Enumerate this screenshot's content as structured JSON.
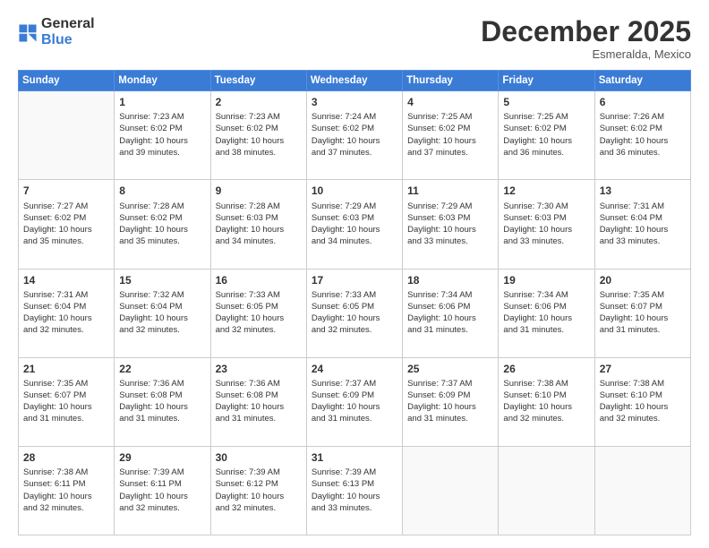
{
  "logo": {
    "general": "General",
    "blue": "Blue"
  },
  "title": "December 2025",
  "location": "Esmeralda, Mexico",
  "days_header": [
    "Sunday",
    "Monday",
    "Tuesday",
    "Wednesday",
    "Thursday",
    "Friday",
    "Saturday"
  ],
  "weeks": [
    [
      {
        "num": "",
        "info": ""
      },
      {
        "num": "1",
        "info": "Sunrise: 7:23 AM\nSunset: 6:02 PM\nDaylight: 10 hours\nand 39 minutes."
      },
      {
        "num": "2",
        "info": "Sunrise: 7:23 AM\nSunset: 6:02 PM\nDaylight: 10 hours\nand 38 minutes."
      },
      {
        "num": "3",
        "info": "Sunrise: 7:24 AM\nSunset: 6:02 PM\nDaylight: 10 hours\nand 37 minutes."
      },
      {
        "num": "4",
        "info": "Sunrise: 7:25 AM\nSunset: 6:02 PM\nDaylight: 10 hours\nand 37 minutes."
      },
      {
        "num": "5",
        "info": "Sunrise: 7:25 AM\nSunset: 6:02 PM\nDaylight: 10 hours\nand 36 minutes."
      },
      {
        "num": "6",
        "info": "Sunrise: 7:26 AM\nSunset: 6:02 PM\nDaylight: 10 hours\nand 36 minutes."
      }
    ],
    [
      {
        "num": "7",
        "info": "Sunrise: 7:27 AM\nSunset: 6:02 PM\nDaylight: 10 hours\nand 35 minutes."
      },
      {
        "num": "8",
        "info": "Sunrise: 7:28 AM\nSunset: 6:02 PM\nDaylight: 10 hours\nand 35 minutes."
      },
      {
        "num": "9",
        "info": "Sunrise: 7:28 AM\nSunset: 6:03 PM\nDaylight: 10 hours\nand 34 minutes."
      },
      {
        "num": "10",
        "info": "Sunrise: 7:29 AM\nSunset: 6:03 PM\nDaylight: 10 hours\nand 34 minutes."
      },
      {
        "num": "11",
        "info": "Sunrise: 7:29 AM\nSunset: 6:03 PM\nDaylight: 10 hours\nand 33 minutes."
      },
      {
        "num": "12",
        "info": "Sunrise: 7:30 AM\nSunset: 6:03 PM\nDaylight: 10 hours\nand 33 minutes."
      },
      {
        "num": "13",
        "info": "Sunrise: 7:31 AM\nSunset: 6:04 PM\nDaylight: 10 hours\nand 33 minutes."
      }
    ],
    [
      {
        "num": "14",
        "info": "Sunrise: 7:31 AM\nSunset: 6:04 PM\nDaylight: 10 hours\nand 32 minutes."
      },
      {
        "num": "15",
        "info": "Sunrise: 7:32 AM\nSunset: 6:04 PM\nDaylight: 10 hours\nand 32 minutes."
      },
      {
        "num": "16",
        "info": "Sunrise: 7:33 AM\nSunset: 6:05 PM\nDaylight: 10 hours\nand 32 minutes."
      },
      {
        "num": "17",
        "info": "Sunrise: 7:33 AM\nSunset: 6:05 PM\nDaylight: 10 hours\nand 32 minutes."
      },
      {
        "num": "18",
        "info": "Sunrise: 7:34 AM\nSunset: 6:06 PM\nDaylight: 10 hours\nand 31 minutes."
      },
      {
        "num": "19",
        "info": "Sunrise: 7:34 AM\nSunset: 6:06 PM\nDaylight: 10 hours\nand 31 minutes."
      },
      {
        "num": "20",
        "info": "Sunrise: 7:35 AM\nSunset: 6:07 PM\nDaylight: 10 hours\nand 31 minutes."
      }
    ],
    [
      {
        "num": "21",
        "info": "Sunrise: 7:35 AM\nSunset: 6:07 PM\nDaylight: 10 hours\nand 31 minutes."
      },
      {
        "num": "22",
        "info": "Sunrise: 7:36 AM\nSunset: 6:08 PM\nDaylight: 10 hours\nand 31 minutes."
      },
      {
        "num": "23",
        "info": "Sunrise: 7:36 AM\nSunset: 6:08 PM\nDaylight: 10 hours\nand 31 minutes."
      },
      {
        "num": "24",
        "info": "Sunrise: 7:37 AM\nSunset: 6:09 PM\nDaylight: 10 hours\nand 31 minutes."
      },
      {
        "num": "25",
        "info": "Sunrise: 7:37 AM\nSunset: 6:09 PM\nDaylight: 10 hours\nand 31 minutes."
      },
      {
        "num": "26",
        "info": "Sunrise: 7:38 AM\nSunset: 6:10 PM\nDaylight: 10 hours\nand 32 minutes."
      },
      {
        "num": "27",
        "info": "Sunrise: 7:38 AM\nSunset: 6:10 PM\nDaylight: 10 hours\nand 32 minutes."
      }
    ],
    [
      {
        "num": "28",
        "info": "Sunrise: 7:38 AM\nSunset: 6:11 PM\nDaylight: 10 hours\nand 32 minutes."
      },
      {
        "num": "29",
        "info": "Sunrise: 7:39 AM\nSunset: 6:11 PM\nDaylight: 10 hours\nand 32 minutes."
      },
      {
        "num": "30",
        "info": "Sunrise: 7:39 AM\nSunset: 6:12 PM\nDaylight: 10 hours\nand 32 minutes."
      },
      {
        "num": "31",
        "info": "Sunrise: 7:39 AM\nSunset: 6:13 PM\nDaylight: 10 hours\nand 33 minutes."
      },
      {
        "num": "",
        "info": ""
      },
      {
        "num": "",
        "info": ""
      },
      {
        "num": "",
        "info": ""
      }
    ]
  ]
}
